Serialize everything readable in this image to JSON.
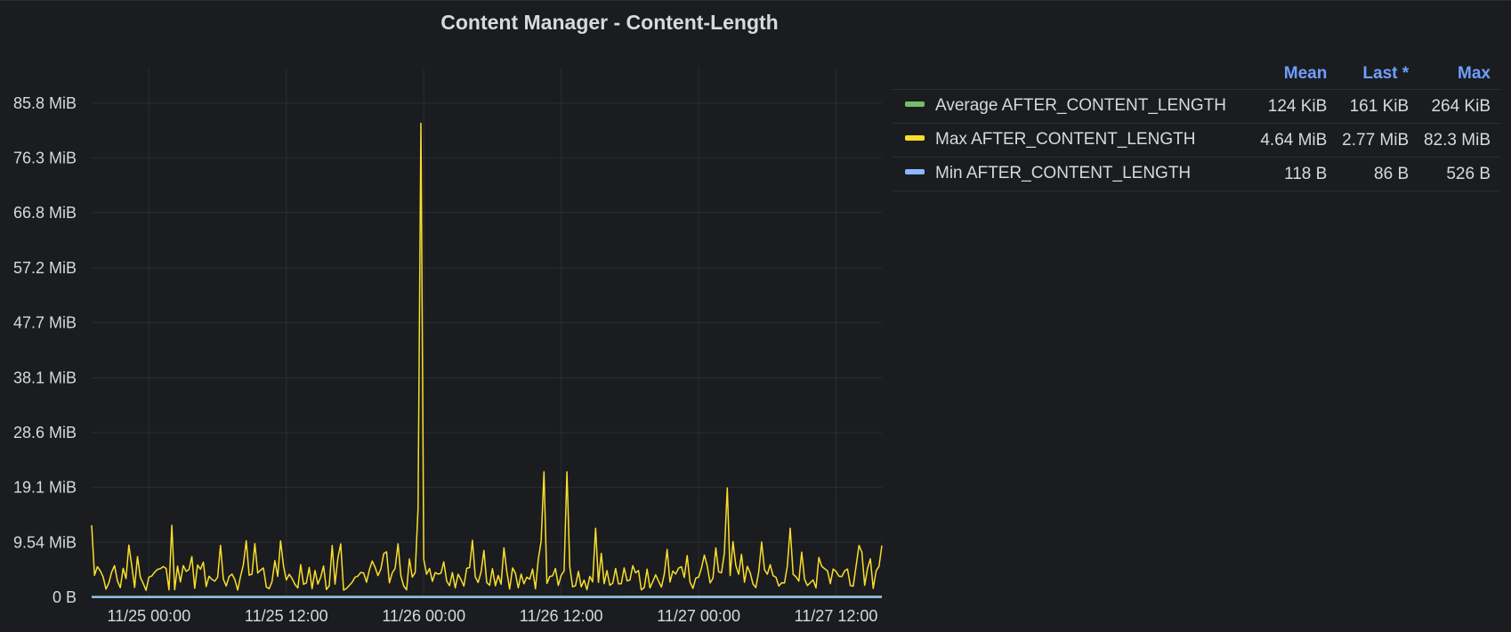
{
  "panel": {
    "title": "Content Manager - Content-Length"
  },
  "legend": {
    "columns": [
      "Mean",
      "Last *",
      "Max"
    ],
    "rows": [
      {
        "name": "Average AFTER_CONTENT_LENGTH",
        "color": "#73bf69",
        "mean": "124 KiB",
        "last": "161 KiB",
        "max": "264 KiB"
      },
      {
        "name": "Max AFTER_CONTENT_LENGTH",
        "color": "#fade2a",
        "mean": "4.64 MiB",
        "last": "2.77 MiB",
        "max": "82.3 MiB"
      },
      {
        "name": "Min AFTER_CONTENT_LENGTH",
        "color": "#8ab8ff",
        "mean": "118 B",
        "last": "86 B",
        "max": "526 B"
      }
    ]
  },
  "chart_data": {
    "type": "line",
    "title": "Content Manager - Content-Length",
    "xlabel": "",
    "ylabel": "",
    "y_unit": "MiB",
    "x_range": [
      "2024-11-24T19:00",
      "2024-11-27T16:00"
    ],
    "ylim": [
      0,
      91.5
    ],
    "x_ticks": [
      {
        "label": "11/25 00:00",
        "t": "2024-11-25T00:00"
      },
      {
        "label": "11/25 12:00",
        "t": "2024-11-25T12:00"
      },
      {
        "label": "11/26 00:00",
        "t": "2024-11-26T00:00"
      },
      {
        "label": "11/26 12:00",
        "t": "2024-11-26T12:00"
      },
      {
        "label": "11/27 00:00",
        "t": "2024-11-27T00:00"
      },
      {
        "label": "11/27 12:00",
        "t": "2024-11-27T12:00"
      }
    ],
    "y_ticks": [
      {
        "label": "0 B",
        "value": 0
      },
      {
        "label": "9.54 MiB",
        "value": 9.54
      },
      {
        "label": "19.1 MiB",
        "value": 19.1
      },
      {
        "label": "28.6 MiB",
        "value": 28.6
      },
      {
        "label": "38.1 MiB",
        "value": 38.1
      },
      {
        "label": "47.7 MiB",
        "value": 47.7
      },
      {
        "label": "57.2 MiB",
        "value": 57.2
      },
      {
        "label": "66.8 MiB",
        "value": 66.8
      },
      {
        "label": "76.3 MiB",
        "value": 76.3
      },
      {
        "label": "85.8 MiB",
        "value": 85.8
      }
    ],
    "grid": true,
    "legend_position": "right",
    "series": [
      {
        "name": "Max AFTER_CONTENT_LENGTH",
        "color": "#fade2a",
        "points": [
          [
            "2024-11-24T19:00",
            12.5
          ],
          [
            "2024-11-24T21:00",
            5.5
          ],
          [
            "2024-11-25T00:00",
            3.5
          ],
          [
            "2024-11-25T02:00",
            12.5
          ],
          [
            "2024-11-25T03:00",
            5.5
          ],
          [
            "2024-11-25T06:00",
            3.5
          ],
          [
            "2024-11-25T09:00",
            4.0
          ],
          [
            "2024-11-25T12:00",
            3.0
          ],
          [
            "2024-11-25T15:00",
            3.5
          ],
          [
            "2024-11-25T16:00",
            9.0
          ],
          [
            "2024-11-25T18:00",
            3.5
          ],
          [
            "2024-11-25T21:00",
            2.5
          ],
          [
            "2024-11-25T23:00",
            3.5
          ],
          [
            "2024-11-25T23:30",
            15.5
          ],
          [
            "2024-11-25T23:45",
            82.3
          ],
          [
            "2024-11-26T00:15",
            4.0
          ],
          [
            "2024-11-26T03:00",
            4.0
          ],
          [
            "2024-11-26T06:00",
            5.0
          ],
          [
            "2024-11-26T09:00",
            3.5
          ],
          [
            "2024-11-26T10:30",
            21.8
          ],
          [
            "2024-11-26T11:30",
            5.0
          ],
          [
            "2024-11-26T12:30",
            21.8
          ],
          [
            "2024-11-26T13:30",
            4.5
          ],
          [
            "2024-11-26T15:00",
            12.0
          ],
          [
            "2024-11-26T18:00",
            3.0
          ],
          [
            "2024-11-26T21:00",
            4.0
          ],
          [
            "2024-11-27T00:00",
            3.5
          ],
          [
            "2024-11-27T02:30",
            19.0
          ],
          [
            "2024-11-27T03:30",
            4.0
          ],
          [
            "2024-11-27T06:00",
            4.0
          ],
          [
            "2024-11-27T08:00",
            12.0
          ],
          [
            "2024-11-27T10:00",
            3.0
          ],
          [
            "2024-11-27T12:00",
            4.5
          ],
          [
            "2024-11-27T14:00",
            9.0
          ],
          [
            "2024-11-27T16:00",
            9.0
          ]
        ]
      },
      {
        "name": "Average AFTER_CONTENT_LENGTH",
        "color": "#73bf69",
        "points": [
          [
            "2024-11-24T19:00",
            0.12
          ],
          [
            "2024-11-27T16:00",
            0.16
          ]
        ]
      },
      {
        "name": "Min AFTER_CONTENT_LENGTH",
        "color": "#8ab8ff",
        "points": [
          [
            "2024-11-24T19:00",
            0.0001
          ],
          [
            "2024-11-27T16:00",
            0.0001
          ]
        ]
      }
    ]
  }
}
